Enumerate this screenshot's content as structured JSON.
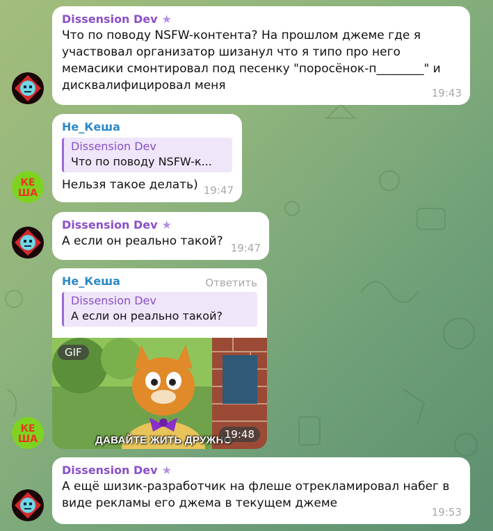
{
  "messages": [
    {
      "sender": "Dissension Dev",
      "text": "Что по поводу NSFW-контента? На прошлом джеме где я участвовал организатор шизанул что я типо про него мемасики смонтировал под песенку \"поросёнок-п________\" и дисквалифицировал меня",
      "time": "19:43"
    },
    {
      "sender": "Не_Кеша",
      "reply_name": "Dissension Dev",
      "reply_text": "Что по поводу NSFW-к...",
      "text": "Нельзя такое делать)",
      "time": "19:47"
    },
    {
      "sender": "Dissension Dev",
      "text": "А если он реально такой?",
      "time": "19:47"
    },
    {
      "sender": "Не_Кеша",
      "reply_button": "Ответить",
      "reply_name": "Dissension Dev",
      "reply_text": "А если он реально такой?",
      "gif_badge": "GIF",
      "gif_caption": "ДАВАЙТЕ ЖИТЬ ДРУЖНО",
      "time": "19:48"
    },
    {
      "sender": "Dissension Dev",
      "text": "А ещё шизик-разработчик на флеше отрекламировал набег в виде рекламы его джема в текущем джеме",
      "time": "19:53"
    }
  ],
  "avatars": {
    "dev_icon": "robot-skull-icon",
    "kesha_icon": "kesha-text-icon",
    "kesha_lines": [
      "КЕ",
      "ША"
    ]
  },
  "colors": {
    "dev_name": "#8a4fc7",
    "kesha_name": "#2b8ac6",
    "time": "#a8a8a8",
    "bubble": "#ffffff"
  }
}
